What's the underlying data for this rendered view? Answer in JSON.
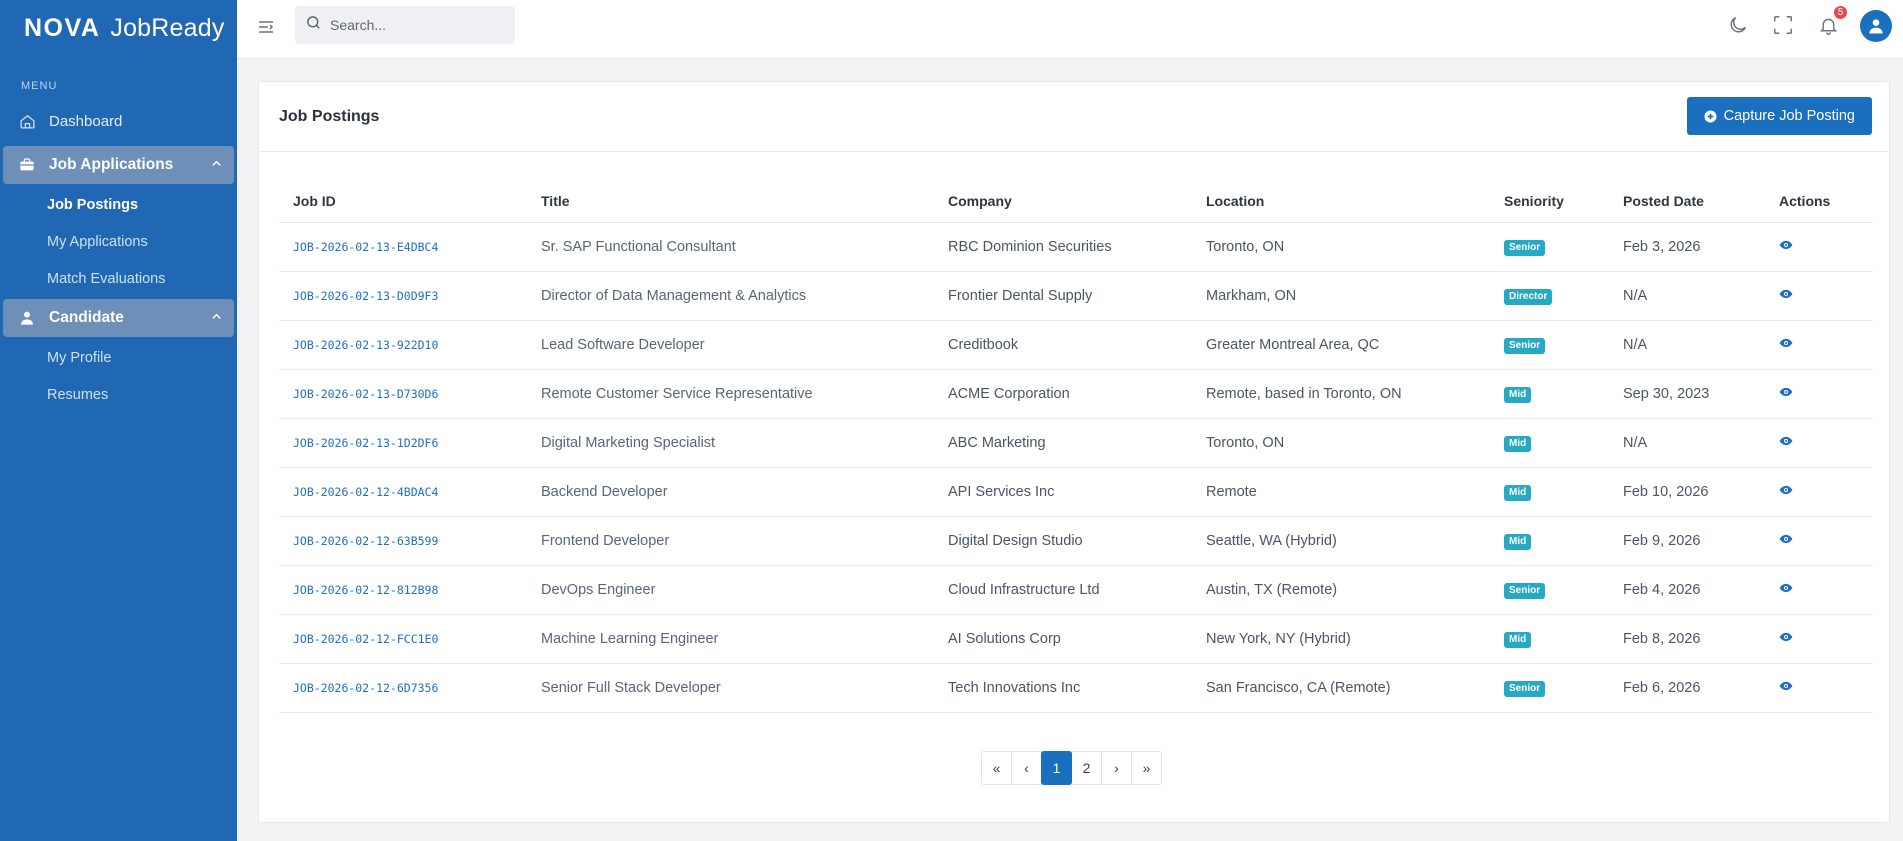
{
  "brand": {
    "name_bold": "NOVA",
    "name_rest": "JobReady"
  },
  "sidebar": {
    "menu_label": "MENU",
    "dashboard": "Dashboard",
    "groups": [
      {
        "label": "Job Applications",
        "items": [
          "Job Postings",
          "My Applications",
          "Match Evaluations"
        ]
      },
      {
        "label": "Candidate",
        "items": [
          "My Profile",
          "Resumes"
        ]
      }
    ]
  },
  "topbar": {
    "search_placeholder": "Search...",
    "notification_count": "5"
  },
  "card": {
    "title": "Job Postings",
    "capture_label": "Capture Job Posting"
  },
  "table": {
    "headers": [
      "Job ID",
      "Title",
      "Company",
      "Location",
      "Seniority",
      "Posted Date",
      "Actions"
    ],
    "rows": [
      [
        "JOB-2026-02-13-E4DBC4",
        "Sr. SAP Functional Consultant",
        "RBC Dominion Securities",
        "Toronto, ON",
        "Senior",
        "Feb 3, 2026"
      ],
      [
        "JOB-2026-02-13-D0D9F3",
        "Director of Data Management & Analytics",
        "Frontier Dental Supply",
        "Markham, ON",
        "Director",
        "N/A"
      ],
      [
        "JOB-2026-02-13-922D10",
        "Lead Software Developer",
        "Creditbook",
        "Greater Montreal Area, QC",
        "Senior",
        "N/A"
      ],
      [
        "JOB-2026-02-13-D730D6",
        "Remote Customer Service Representative",
        "ACME Corporation",
        "Remote, based in Toronto, ON",
        "Mid",
        "Sep 30, 2023"
      ],
      [
        "JOB-2026-02-13-1D2DF6",
        "Digital Marketing Specialist",
        "ABC Marketing",
        "Toronto, ON",
        "Mid",
        "N/A"
      ],
      [
        "JOB-2026-02-12-4BDAC4",
        "Backend Developer",
        "API Services Inc",
        "Remote",
        "Mid",
        "Feb 10, 2026"
      ],
      [
        "JOB-2026-02-12-63B599",
        "Frontend Developer",
        "Digital Design Studio",
        "Seattle, WA (Hybrid)",
        "Mid",
        "Feb 9, 2026"
      ],
      [
        "JOB-2026-02-12-812B98",
        "DevOps Engineer",
        "Cloud Infrastructure Ltd",
        "Austin, TX (Remote)",
        "Senior",
        "Feb 4, 2026"
      ],
      [
        "JOB-2026-02-12-FCC1E0",
        "Machine Learning Engineer",
        "AI Solutions Corp",
        "New York, NY (Hybrid)",
        "Mid",
        "Feb 8, 2026"
      ],
      [
        "JOB-2026-02-12-6D7356",
        "Senior Full Stack Developer",
        "Tech Innovations Inc",
        "San Francisco, CA (Remote)",
        "Senior",
        "Feb 6, 2026"
      ]
    ]
  },
  "pagination": {
    "first": "«",
    "prev": "‹",
    "pages": [
      "1",
      "2"
    ],
    "current": "1",
    "next": "›",
    "last": "»"
  },
  "colors": {
    "sidebar": "#2168b4",
    "primary": "#1a6fbf",
    "badge": "#26a9c4",
    "link": "#1f6fc2",
    "notification": "#e5484d"
  },
  "icons": [
    "home-icon",
    "briefcase-icon",
    "user-icon",
    "chevron-up-icon",
    "menu-icon",
    "search-icon",
    "moon-icon",
    "fullscreen-icon",
    "bell-icon",
    "avatar-icon",
    "plus-circle-icon",
    "eye-icon"
  ]
}
